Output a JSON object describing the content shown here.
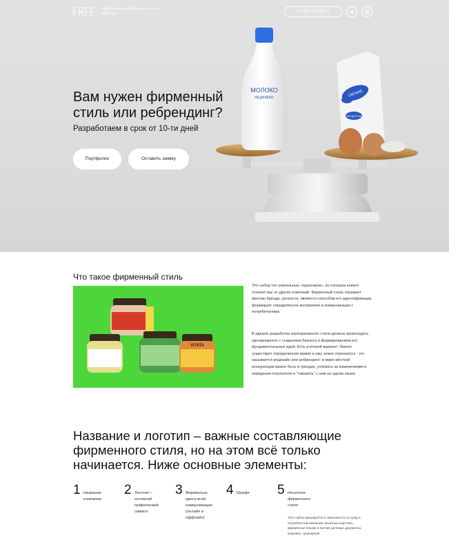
{
  "header": {
    "logo_text": "FREE",
    "tagline": "Разрабатываем фирменные стили с 2009 года",
    "phone": "8 (495) 155-38-11",
    "icons": [
      "telegram-icon",
      "instagram-icon"
    ]
  },
  "hero": {
    "title": "Вам нужен фирменный стиль или ребрендинг?",
    "subtitle": "Разработаем в срок от 10-ти дней",
    "btn_portfolio": "Портфолио",
    "btn_request": "Оставить заявку",
    "bottle_brand": "МОЛОКО",
    "bottle_sub": "НЕДАЛЕКО",
    "bag_label_1": "СВЕЖИЕ",
    "bag_label_2": "МОЩЕ",
    "bag_label_3": "ПРОДУКТЫ"
  },
  "identity": {
    "title": "Что такое фирменный стиль",
    "para1": "Это набор тех уникальных «признаков», по которым клиент отличит вас от других компаний. Фирменный стиль отражает миссию бренда, ценности, является способом его идентификации, формирует определённое восприятие в коммуникации с потребителями.",
    "para2": "В идеале разработка корпоративного стиля должна происходить одновременно с созданием бизнеса и формированием его фундаментальных идей. Есть и второй вариант: бизнес существует определенное время и ему нужен перезапуск - это называется редизайн или ребрендинг: в мире жёсткой конкуренции важно быть в трендах, успевать за изменениями в поведении покупателя и \"говорить\" с ним на одном языке.",
    "jar_brand": "VITATA"
  },
  "elements": {
    "heading": "Название и логотип – важные составляющие фирменного стиля, но на этом всё только начинается. Ниже основные элементы:",
    "items": [
      {
        "num": "1",
        "label": "Название компании"
      },
      {
        "num": "2",
        "label": "Логотип – основной графический символ"
      },
      {
        "num": "3",
        "label": "Фирменные цвета всей коммуникации (онлайн и оффлайн)"
      },
      {
        "num": "4",
        "label": "Шрифт"
      },
      {
        "num": "5",
        "label": "Носители фирменного стиля",
        "desc": "Этот набор варьируется в зависимости от нужд и потребностей компании: визитные карточки, фирменные бланки и прочие деловые документы, упаковка, сувенирная"
      }
    ]
  },
  "colors": {
    "accent_green": "#4dd63a",
    "hero_bg": "#dcdcdc",
    "bottle_cap": "#2d6fe0"
  }
}
